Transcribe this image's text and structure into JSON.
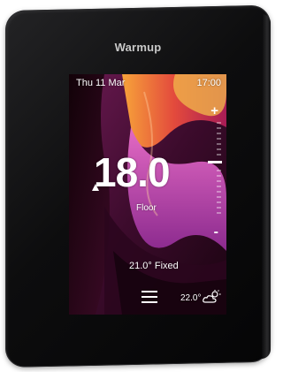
{
  "device": {
    "brand": "Warmup"
  },
  "status_bar": {
    "date": "Thu 11 Mar",
    "time": "17:00"
  },
  "thermostat": {
    "setpoint": "18.0",
    "mode_label": "Floor",
    "program_label": "21.0° Fixed",
    "increase_label": "+",
    "decrease_label": "-"
  },
  "footer": {
    "menu_icon": "menu-icon",
    "weather_temp": "22.0°",
    "weather_icon": "partly-cloudy-icon"
  },
  "colors": {
    "screen_text": "#ffffff",
    "bezel": "#0d0d0e",
    "brand_text": "#c9c9c9"
  }
}
